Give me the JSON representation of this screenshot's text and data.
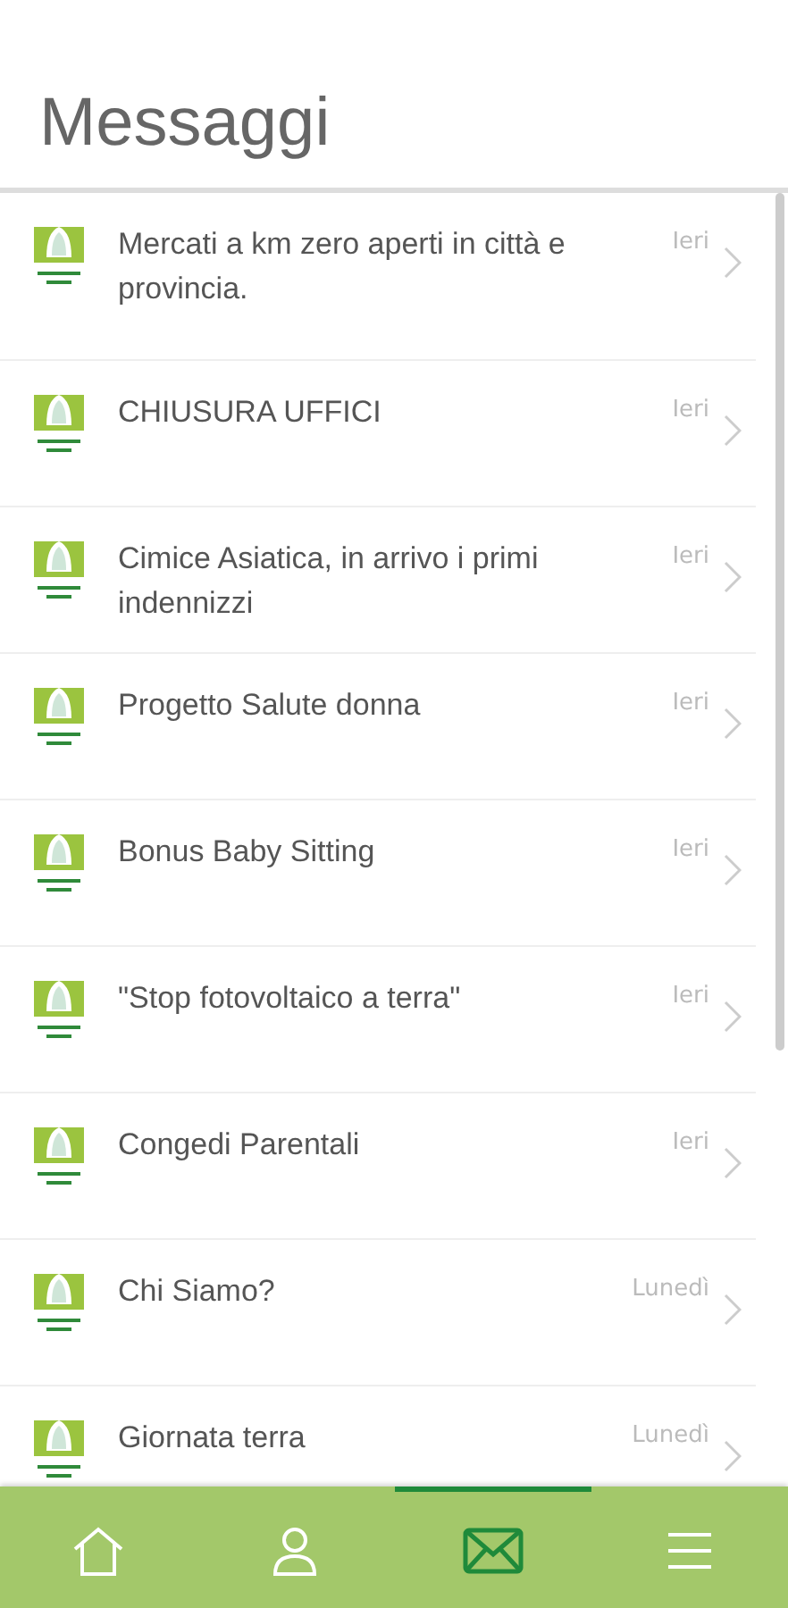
{
  "header": {
    "title": "Messaggi"
  },
  "messages": [
    {
      "title": "Mercati a km zero aperti in città e provincia.",
      "date": "Ieri"
    },
    {
      "title": "CHIUSURA UFFICI",
      "date": "Ieri"
    },
    {
      "title": "Cimice Asiatica, in arrivo i primi indennizzi",
      "date": "Ieri"
    },
    {
      "title": "Progetto Salute donna",
      "date": "Ieri"
    },
    {
      "title": "Bonus Baby Sitting",
      "date": "Ieri"
    },
    {
      "title": "\"Stop fotovoltaico a terra\"",
      "date": "Ieri"
    },
    {
      "title": "Congedi Parentali",
      "date": "Ieri"
    },
    {
      "title": "Chi Siamo?",
      "date": "Lunedì"
    },
    {
      "title": "Giornata terra",
      "date": "Lunedì"
    }
  ],
  "nav": [
    {
      "kind": "home",
      "selected": false
    },
    {
      "kind": "profile",
      "selected": false
    },
    {
      "kind": "messages",
      "selected": true
    },
    {
      "kind": "menu",
      "selected": false
    }
  ]
}
